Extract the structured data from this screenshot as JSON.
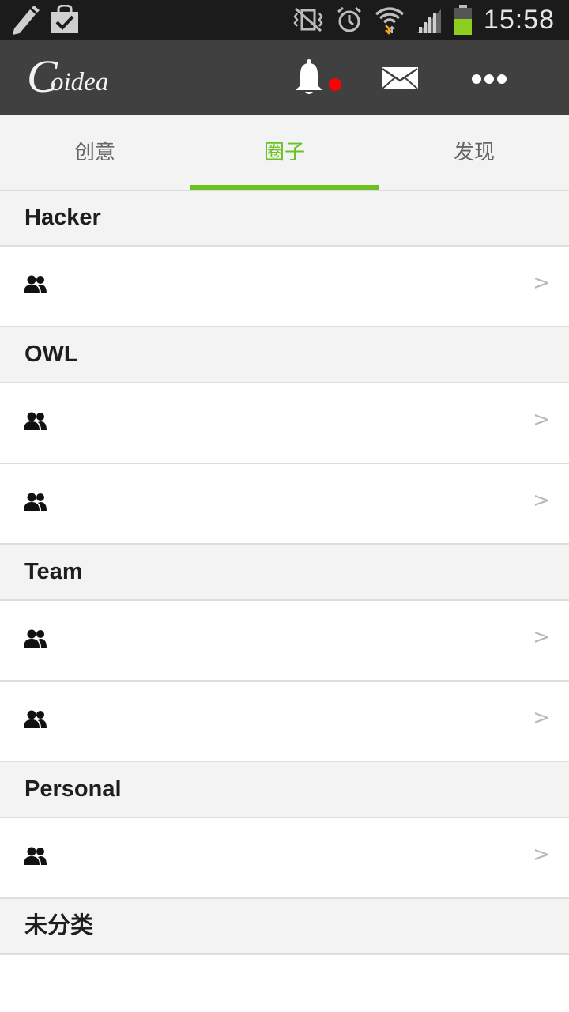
{
  "status_bar": {
    "time": "15:58",
    "icons": [
      "pencil-icon",
      "bag-check-icon",
      "vibrate-icon",
      "alarm-icon",
      "wifi-icon",
      "signal-icon",
      "battery-icon"
    ]
  },
  "app_bar": {
    "logo_text": "Coidea",
    "actions": [
      "bell-icon",
      "mail-icon",
      "more-icon"
    ],
    "notification_dot_color": "#ff0000",
    "background": "#404040"
  },
  "tabs": [
    {
      "label": "创意",
      "active": false
    },
    {
      "label": "圈子",
      "active": true
    },
    {
      "label": "发现",
      "active": false
    }
  ],
  "accent_color": "#6ac11f",
  "sections": [
    {
      "header": "Hacker"
    },
    {
      "header": "OWL"
    },
    {
      "header": "Team"
    },
    {
      "header": "Personal"
    },
    {
      "header": "未分类"
    }
  ],
  "row_chevron": ">"
}
